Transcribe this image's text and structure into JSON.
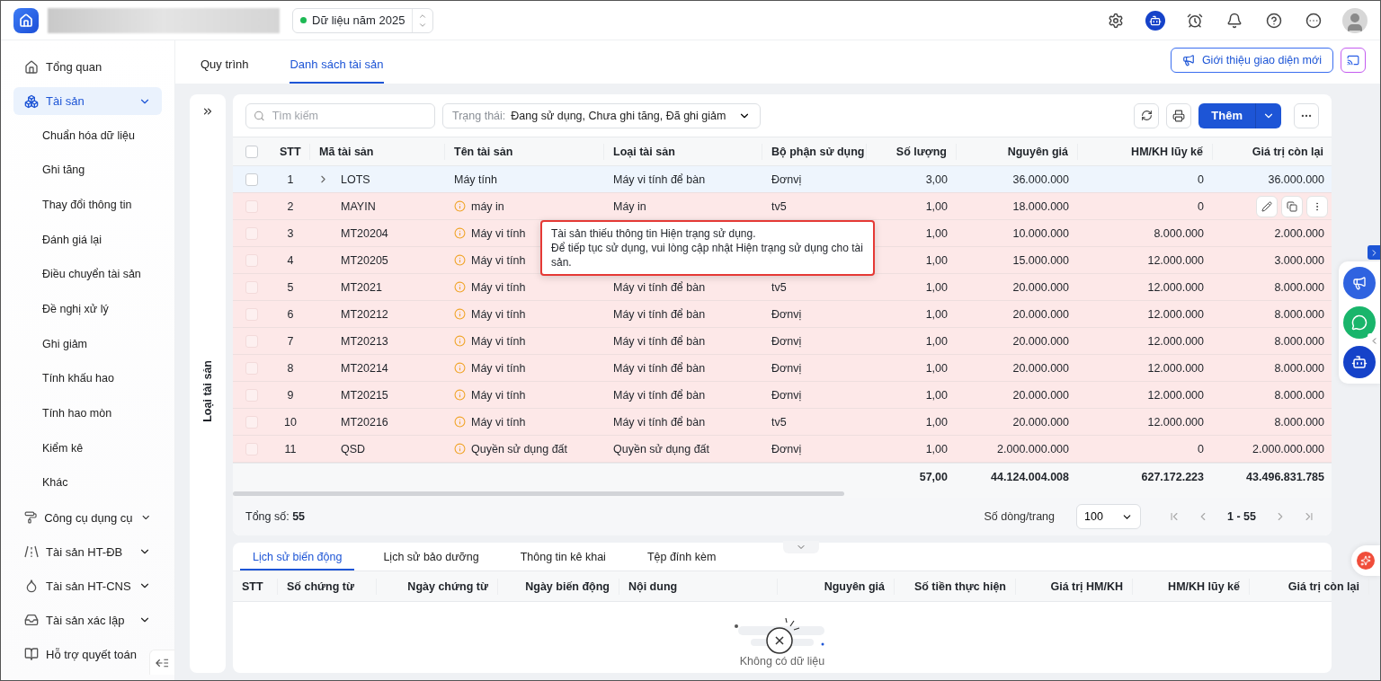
{
  "header": {
    "year_selector": {
      "label": "Dữ liệu năm 2025"
    }
  },
  "sidebar": {
    "items": [
      {
        "kind": "link",
        "label": "Tổng quan",
        "selected": false
      },
      {
        "kind": "group",
        "label": "Tài sản",
        "selected": true,
        "expanded": true,
        "children": [
          {
            "label": "Chuẩn hóa dữ liệu",
            "selected": false
          },
          {
            "label": "Ghi tăng",
            "selected": false
          },
          {
            "label": "Thay đổi thông tin",
            "selected": false
          },
          {
            "label": "Đánh giá lại",
            "selected": false
          },
          {
            "label": "Điều chuyển tài sản",
            "selected": false
          },
          {
            "label": "Đề nghị xử lý",
            "selected": false
          },
          {
            "label": "Ghi giảm",
            "selected": false
          },
          {
            "label": "Tính khấu hao",
            "selected": false
          },
          {
            "label": "Tính hao mòn",
            "selected": false
          },
          {
            "label": "Kiểm kê",
            "selected": false
          },
          {
            "label": "Khác",
            "selected": false
          }
        ]
      },
      {
        "kind": "group",
        "label": "Công cụ dụng cụ",
        "selected": false,
        "expanded": false
      },
      {
        "kind": "group",
        "label": "Tài sản HT-ĐB",
        "selected": false,
        "expanded": false
      },
      {
        "kind": "group",
        "label": "Tài sản HT-CNS",
        "selected": false,
        "expanded": false
      },
      {
        "kind": "group",
        "label": "Tài sản xác lập",
        "selected": false,
        "expanded": false
      },
      {
        "kind": "link",
        "label": "Hỗ trợ quyết toán",
        "selected": false
      }
    ]
  },
  "page_tabs": [
    {
      "label": "Quy trình",
      "selected": false
    },
    {
      "label": "Danh sách tài sản",
      "selected": true
    }
  ],
  "intro_button": {
    "label": "Giới thiệu giao diện mới"
  },
  "side_panel": {
    "title": "Loại tài sản"
  },
  "toolbar": {
    "search": {
      "placeholder": "Tìm kiếm"
    },
    "status_filter": {
      "label": "Trạng thái:",
      "value": "Đang sử dụng, Chưa ghi tăng, Đã ghi giảm"
    },
    "add_button": {
      "label": "Thêm"
    }
  },
  "table": {
    "all_checked": false,
    "columns": [
      "STT",
      "Mã tài sản",
      "Tên tài sản",
      "Loại tài sản",
      "Bộ phận sử dụng",
      "Số lượng",
      "Nguyên giá",
      "HM/KH lũy kế",
      "Giá trị còn lại"
    ],
    "rows": [
      {
        "stt": "1",
        "code": "LOTS",
        "name": "Máy tính",
        "type": "Máy vi tính để bàn",
        "department": "Đơnvị",
        "quantity": "3,00",
        "cost": "36.000.000",
        "accumulated": "0",
        "remaining": "36.000.000",
        "selected": true,
        "checked": false,
        "warning": false,
        "expandable": true,
        "actions_shown": false
      },
      {
        "stt": "2",
        "code": "MAYIN",
        "name": "máy in",
        "type": "Máy in",
        "department": "tv5",
        "quantity": "1,00",
        "cost": "18.000.000",
        "accumulated": "0",
        "selected": false,
        "checked": false,
        "warning": true,
        "expandable": false,
        "actions_shown": true
      },
      {
        "stt": "3",
        "code": "MT20204",
        "name": "Máy vi tính",
        "quantity": "1,00",
        "cost": "10.000.000",
        "accumulated": "8.000.000",
        "remaining": "2.000.000",
        "selected": false,
        "checked": false,
        "warning": true,
        "expandable": false,
        "actions_shown": false
      },
      {
        "stt": "4",
        "code": "MT20205",
        "name": "Máy vi tính",
        "quantity": "1,00",
        "cost": "15.000.000",
        "accumulated": "12.000.000",
        "remaining": "3.000.000",
        "selected": false,
        "checked": false,
        "warning": true,
        "expandable": false,
        "actions_shown": false
      },
      {
        "stt": "5",
        "code": "MT2021",
        "name": "Máy vi tính",
        "type": "Máy vi tính để bàn",
        "department": "tv5",
        "quantity": "1,00",
        "cost": "20.000.000",
        "accumulated": "12.000.000",
        "remaining": "8.000.000",
        "selected": false,
        "checked": false,
        "warning": true,
        "expandable": false,
        "actions_shown": false
      },
      {
        "stt": "6",
        "code": "MT20212",
        "name": "Máy vi tính",
        "type": "Máy vi tính để bàn",
        "department": "Đơnvị",
        "quantity": "1,00",
        "cost": "20.000.000",
        "accumulated": "12.000.000",
        "remaining": "8.000.000",
        "selected": false,
        "checked": false,
        "warning": true,
        "expandable": false,
        "actions_shown": false
      },
      {
        "stt": "7",
        "code": "MT20213",
        "name": "Máy vi tính",
        "type": "Máy vi tính để bàn",
        "department": "Đơnvị",
        "quantity": "1,00",
        "cost": "20.000.000",
        "accumulated": "12.000.000",
        "remaining": "8.000.000",
        "selected": false,
        "checked": false,
        "warning": true,
        "expandable": false,
        "actions_shown": false
      },
      {
        "stt": "8",
        "code": "MT20214",
        "name": "Máy vi tính",
        "type": "Máy vi tính để bàn",
        "department": "Đơnvị",
        "quantity": "1,00",
        "cost": "20.000.000",
        "accumulated": "12.000.000",
        "remaining": "8.000.000",
        "selected": false,
        "checked": false,
        "warning": true,
        "expandable": false,
        "actions_shown": false
      },
      {
        "stt": "9",
        "code": "MT20215",
        "name": "Máy vi tính",
        "type": "Máy vi tính để bàn",
        "department": "Đơnvị",
        "quantity": "1,00",
        "cost": "20.000.000",
        "accumulated": "12.000.000",
        "remaining": "8.000.000",
        "selected": false,
        "checked": false,
        "warning": true,
        "expandable": false,
        "actions_shown": false
      },
      {
        "stt": "10",
        "code": "MT20216",
        "name": "Máy vi tính",
        "type": "Máy vi tính để bàn",
        "department": "tv5",
        "quantity": "1,00",
        "cost": "20.000.000",
        "accumulated": "12.000.000",
        "remaining": "8.000.000",
        "selected": false,
        "checked": false,
        "warning": true,
        "expandable": false,
        "actions_shown": false
      },
      {
        "stt": "11",
        "code": "QSD",
        "name": "Quyền sử dụng đất",
        "type": "Quyền sử dụng đất",
        "department": "Đơnvị",
        "quantity": "1,00",
        "cost": "2.000.000.000",
        "accumulated": "0",
        "remaining": "2.000.000.000",
        "selected": false,
        "checked": false,
        "warning": true,
        "expandable": false,
        "actions_shown": false
      }
    ],
    "totals": {
      "quantity": "57,00",
      "cost": "44.124.004.008",
      "accumulated": "627.172.223",
      "remaining": "43.496.831.785"
    }
  },
  "tooltip": {
    "lines": [
      "Tài sản thiếu thông tin Hiện trạng sử dụng.",
      "Để tiếp tục sử dụng, vui lòng cập nhật Hiện trạng sử dụng cho tài sản."
    ]
  },
  "footer": {
    "total": "Tổng số: **55**",
    "page_size_label": "Số dòng/trang",
    "page_size": "100",
    "range": "1 - 55"
  },
  "detail": {
    "tabs": [
      {
        "label": "Lịch sử biến động",
        "selected": true
      },
      {
        "label": "Lịch sử bảo dưỡng",
        "selected": false
      },
      {
        "label": "Thông tin kê khai",
        "selected": false
      },
      {
        "label": "Tệp đính kèm",
        "selected": false
      }
    ],
    "columns": [
      "STT",
      "Số chứng từ",
      "Ngày chứng từ",
      "Ngày biến động",
      "Nội dung",
      "Nguyên giá",
      "Số tiền thực hiện",
      "Giá trị HM/KH",
      "HM/KH lũy kế",
      "Giá trị còn lại"
    ],
    "empty_text": "Không có dữ liệu"
  }
}
